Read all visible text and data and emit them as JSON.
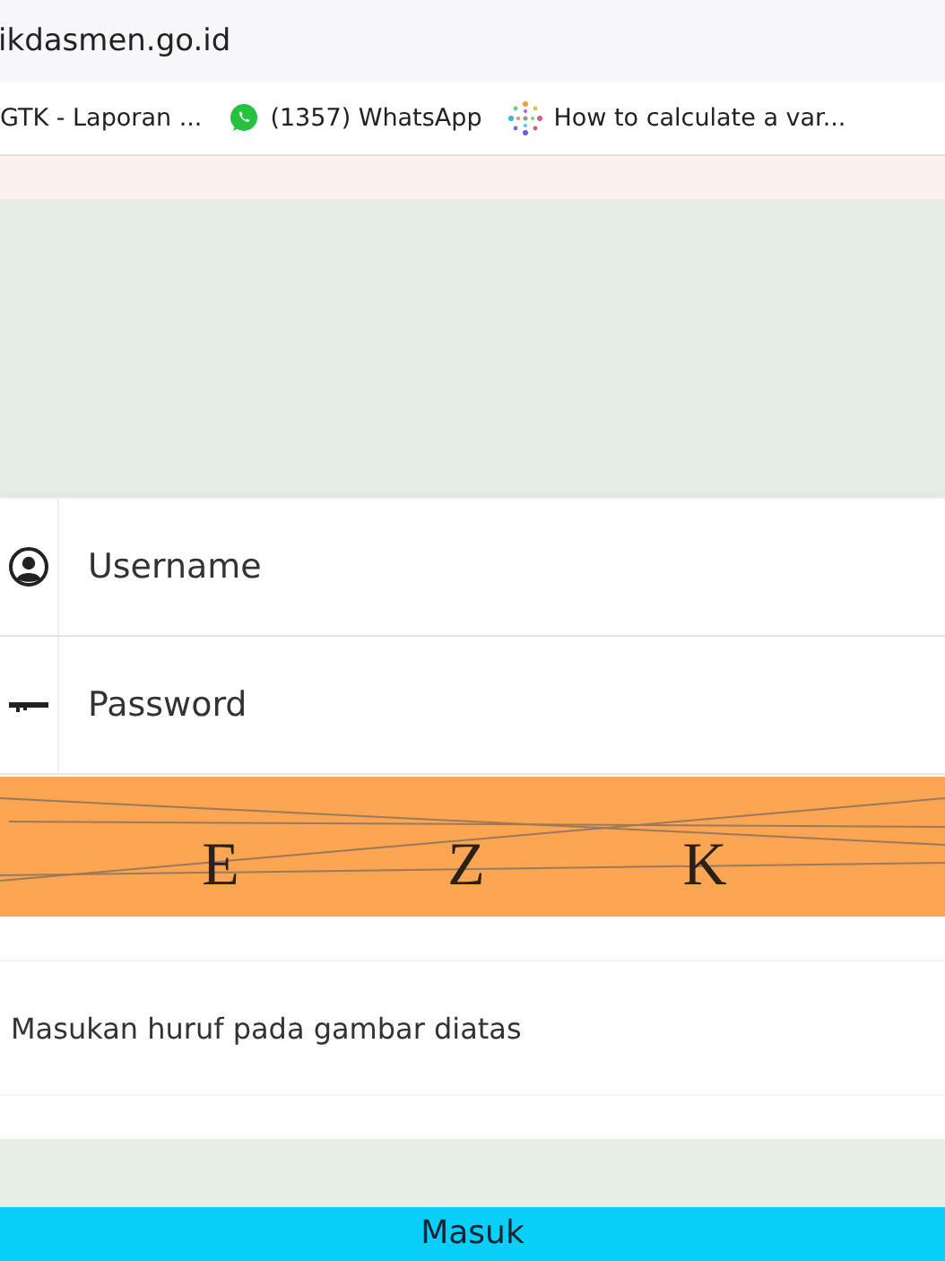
{
  "address_bar": {
    "url": "ikdasmen.go.id"
  },
  "bookmarks": [
    {
      "label": "GTK - Laporan ..."
    },
    {
      "label": "(1357) WhatsApp"
    },
    {
      "label": "How to calculate a var..."
    }
  ],
  "login": {
    "fields": [
      {
        "kind": "user",
        "placeholder": "Username"
      },
      {
        "kind": "key",
        "placeholder": "Password"
      }
    ],
    "captcha": {
      "letters": [
        "E",
        "Z",
        "K"
      ]
    },
    "captcha_input": {
      "placeholder": "Masukan huruf pada gambar diatas"
    },
    "submit": "Masuk"
  }
}
